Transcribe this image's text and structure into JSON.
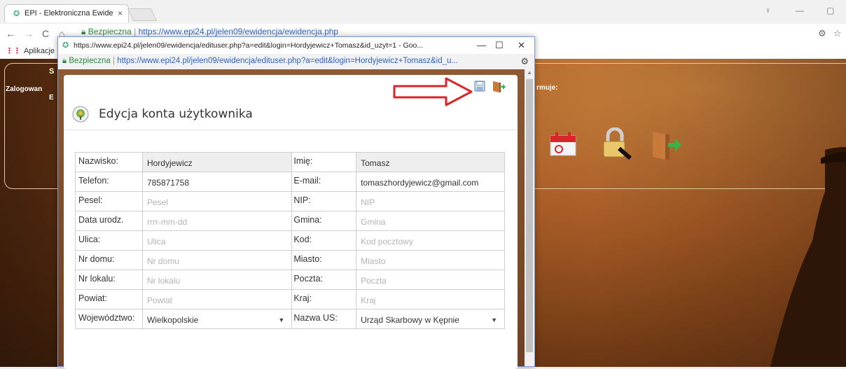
{
  "browser": {
    "tab_title": "EPI - Elektroniczna Ewide",
    "tab_close": "×",
    "address_secure": "Bezpieczna",
    "address_url": "https://www.epi24.pl/jelen09/ewidencja/ewidencja.php",
    "bookmarks_apps": "Aplikacje",
    "win_min": "—",
    "win_max": "▢"
  },
  "background_page": {
    "s_letter": "S",
    "logged_label": "Zalogowan",
    "logged_label2": "E",
    "informuje": "rmuje:"
  },
  "popup": {
    "title": "https://www.epi24.pl/jelen09/ewidencja/edituser.php?a=edit&login=Hordyjewicz+Tomasz&id_uzyt=1 - Goo...",
    "min": "—",
    "max": "☐",
    "close": "✕",
    "address_secure": "Bezpieczna",
    "address_url": "https://www.epi24.pl/jelen09/ewidencja/edituser.php?a=edit&login=Hordyjewicz+Tomasz&id_u..."
  },
  "modal": {
    "title": "Edycja konta użytkownika"
  },
  "form": {
    "rows": [
      {
        "l1": "Nazwisko:",
        "v1": "Hordyjewicz",
        "p1": false,
        "l2": "Imię:",
        "v2": "Tomasz",
        "p2": false
      },
      {
        "l1": "Telefon:",
        "v1": "785871758",
        "p1": false,
        "l2": "E-mail:",
        "v2": "tomaszhordyjewicz@gmail.com",
        "p2": false
      },
      {
        "l1": "Pesel:",
        "v1": "Pesel",
        "p1": true,
        "l2": "NIP:",
        "v2": "NIP",
        "p2": true
      },
      {
        "l1": "Data urodz.",
        "v1": "rrrr-mm-dd",
        "p1": true,
        "l2": "Gmina:",
        "v2": "Gmina",
        "p2": true
      },
      {
        "l1": "Ulica:",
        "v1": "Ulica",
        "p1": true,
        "l2": "Kod:",
        "v2": "Kod pocztowy",
        "p2": true
      },
      {
        "l1": "Nr domu:",
        "v1": "Nr domu",
        "p1": true,
        "l2": "Miasto:",
        "v2": "Miasto",
        "p2": true
      },
      {
        "l1": "Nr lokalu:",
        "v1": "Nr lokalu",
        "p1": true,
        "l2": "Poczta:",
        "v2": "Poczta",
        "p2": true
      },
      {
        "l1": "Powiat:",
        "v1": "Powiat",
        "p1": true,
        "l2": "Kraj:",
        "v2": "Kraj",
        "p2": true
      }
    ],
    "last": {
      "l1": "Województwo:",
      "v1": "Wielkopolskie",
      "l2": "Nazwa US:",
      "v2": "Urząd Skarbowy w Kępnie"
    }
  },
  "colors": {
    "accent_arrow": "#d9262b",
    "link_blue": "#2a63c4",
    "secure_green": "#2a8a3a"
  }
}
